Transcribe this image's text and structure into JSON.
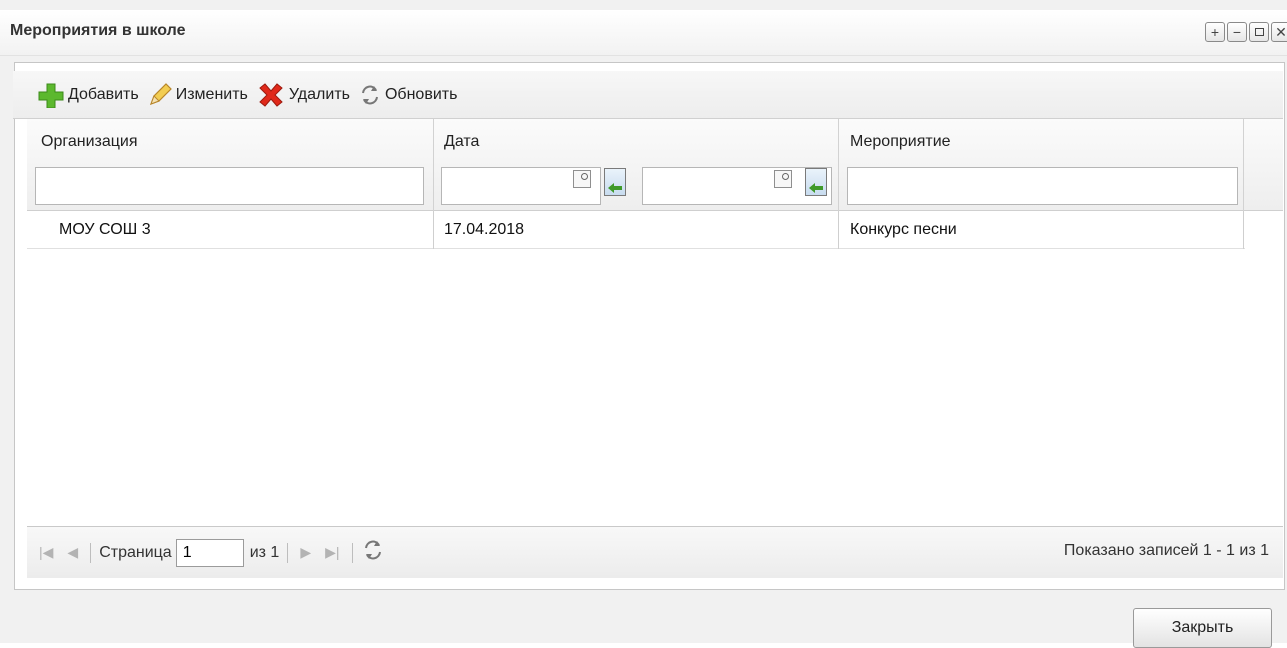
{
  "window": {
    "title": "Мероприятия в школе"
  },
  "toolbar": {
    "add_label": "Добавить",
    "edit_label": "Изменить",
    "delete_label": "Удалить",
    "refresh_label": "Обновить"
  },
  "grid": {
    "columns": [
      "Организация",
      "Дата",
      "Мероприятие"
    ],
    "rows": [
      {
        "organization": "МОУ СОШ 3",
        "date": "17.04.2018",
        "event": "Конкурс песни"
      }
    ]
  },
  "pager": {
    "page_label": "Страница",
    "page_value": "1",
    "of_label": "из 1",
    "info": "Показано записей 1 - 1 из 1"
  },
  "footer": {
    "close_label": "Закрыть"
  },
  "icons": {
    "add": "plus-icon",
    "edit": "pencil-icon",
    "delete": "x-icon",
    "refresh": "refresh-icon"
  },
  "colors": {
    "add_icon": "#5cb82e",
    "delete_icon": "#e0291a",
    "edit_icon": "#e8b838",
    "picker_arrow": "#3f9a2a"
  }
}
